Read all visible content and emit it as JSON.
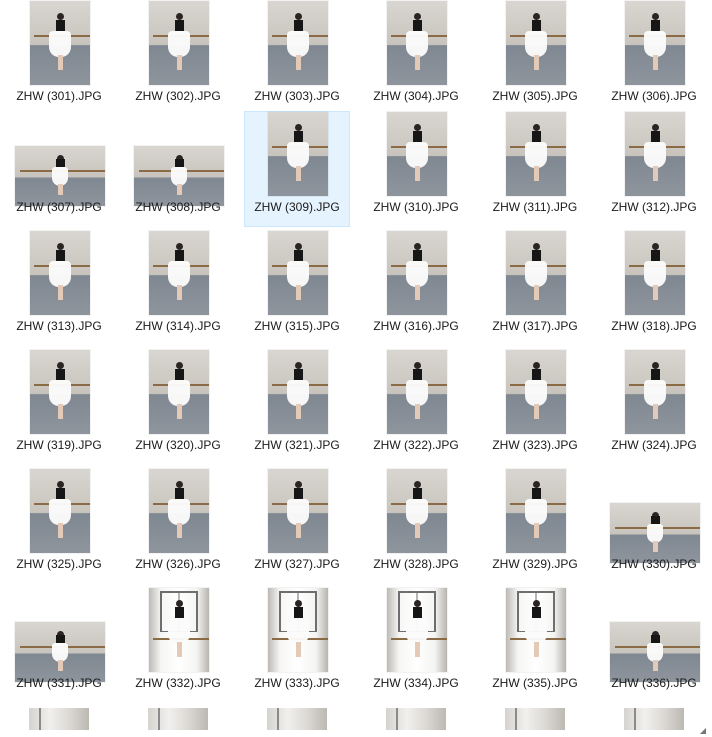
{
  "explorer": {
    "items": [
      {
        "name": "ZHW (301).JPG",
        "orientation": "portrait",
        "selected": false
      },
      {
        "name": "ZHW (302).JPG",
        "orientation": "portrait",
        "selected": false
      },
      {
        "name": "ZHW (303).JPG",
        "orientation": "portrait",
        "selected": false
      },
      {
        "name": "ZHW (304).JPG",
        "orientation": "portrait",
        "selected": false
      },
      {
        "name": "ZHW (305).JPG",
        "orientation": "portrait",
        "selected": false
      },
      {
        "name": "ZHW (306).JPG",
        "orientation": "portrait",
        "selected": false
      },
      {
        "name": "ZHW (307).JPG",
        "orientation": "landscape",
        "selected": false
      },
      {
        "name": "ZHW (308).JPG",
        "orientation": "landscape",
        "selected": false
      },
      {
        "name": "ZHW (309).JPG",
        "orientation": "portrait",
        "selected": true
      },
      {
        "name": "ZHW (310).JPG",
        "orientation": "portrait",
        "selected": false
      },
      {
        "name": "ZHW (311).JPG",
        "orientation": "portrait",
        "selected": false
      },
      {
        "name": "ZHW (312).JPG",
        "orientation": "portrait",
        "selected": false
      },
      {
        "name": "ZHW (313).JPG",
        "orientation": "portrait",
        "selected": false
      },
      {
        "name": "ZHW (314).JPG",
        "orientation": "portrait",
        "selected": false
      },
      {
        "name": "ZHW (315).JPG",
        "orientation": "portrait",
        "selected": false
      },
      {
        "name": "ZHW (316).JPG",
        "orientation": "portrait",
        "selected": false
      },
      {
        "name": "ZHW (317).JPG",
        "orientation": "portrait",
        "selected": false
      },
      {
        "name": "ZHW (318).JPG",
        "orientation": "portrait",
        "selected": false
      },
      {
        "name": "ZHW (319).JPG",
        "orientation": "portrait",
        "selected": false
      },
      {
        "name": "ZHW (320).JPG",
        "orientation": "portrait",
        "selected": false
      },
      {
        "name": "ZHW (321).JPG",
        "orientation": "portrait",
        "selected": false
      },
      {
        "name": "ZHW (322).JPG",
        "orientation": "portrait",
        "selected": false
      },
      {
        "name": "ZHW (323).JPG",
        "orientation": "portrait",
        "selected": false
      },
      {
        "name": "ZHW (324).JPG",
        "orientation": "portrait",
        "selected": false
      },
      {
        "name": "ZHW (325).JPG",
        "orientation": "portrait",
        "selected": false
      },
      {
        "name": "ZHW (326).JPG",
        "orientation": "portrait",
        "selected": false
      },
      {
        "name": "ZHW (327).JPG",
        "orientation": "portrait",
        "selected": false
      },
      {
        "name": "ZHW (328).JPG",
        "orientation": "portrait",
        "selected": false
      },
      {
        "name": "ZHW (329).JPG",
        "orientation": "portrait",
        "selected": false
      },
      {
        "name": "ZHW (330).JPG",
        "orientation": "landscape",
        "selected": false
      },
      {
        "name": "ZHW (331).JPG",
        "orientation": "landscape",
        "selected": false
      },
      {
        "name": "ZHW (332).JPG",
        "orientation": "portrait-window",
        "selected": false
      },
      {
        "name": "ZHW (333).JPG",
        "orientation": "portrait-window",
        "selected": false
      },
      {
        "name": "ZHW (334).JPG",
        "orientation": "portrait-window",
        "selected": false
      },
      {
        "name": "ZHW (335).JPG",
        "orientation": "portrait-window",
        "selected": false
      },
      {
        "name": "ZHW (336).JPG",
        "orientation": "landscape",
        "selected": false
      }
    ],
    "partial_row_count": 6,
    "selection_color": "#e5f3ff",
    "selection_border_color": "#cce8ff"
  }
}
